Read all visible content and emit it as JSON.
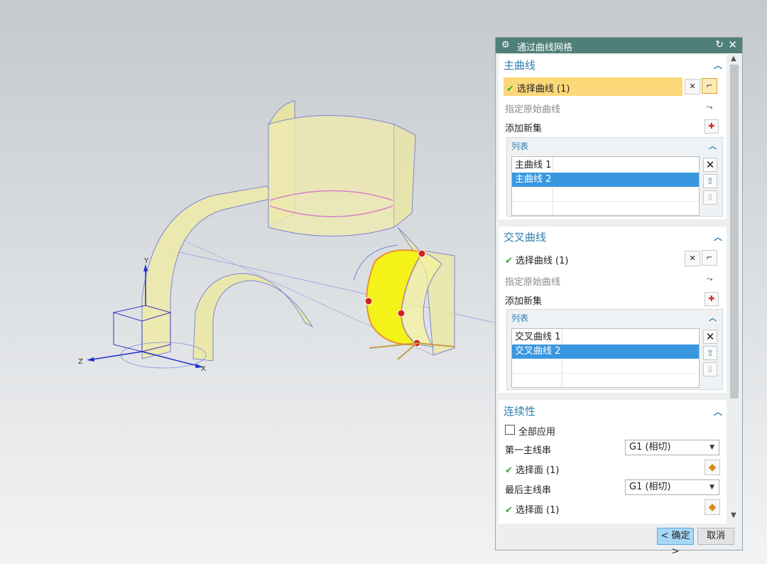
{
  "dialog": {
    "title": "通过曲线网格",
    "icons": {
      "title": "gear-icon",
      "reset": "reset-icon",
      "close": "close-icon"
    }
  },
  "primary": {
    "title": "主曲线",
    "select_label": "选择曲线 (1)",
    "specify_label": "指定原始曲线",
    "add_set_label": "添加新集",
    "list_title": "列表",
    "items": [
      "主曲线 1",
      "主曲线 2"
    ]
  },
  "cross": {
    "title": "交叉曲线",
    "select_label": "选择曲线 (1)",
    "specify_label": "指定原始曲线",
    "add_set_label": "添加新集",
    "list_title": "列表",
    "items": [
      "交叉曲线 1",
      "交叉曲线 2"
    ]
  },
  "continuity": {
    "title": "连续性",
    "apply_all_label": "全部应用",
    "first_label": "第一主线串",
    "first_value": "G1 (相切)",
    "face1_label": "选择面 (1)",
    "last_label": "最后主线串",
    "last_value": "G1 (相切)",
    "face2_label": "选择面 (1)"
  },
  "buttons": {
    "ok": "< 确定 >",
    "cancel": "取消"
  },
  "axes": {
    "x": "X",
    "y": "Y",
    "z": "Z"
  },
  "colors": {
    "accent": "#2e7fae",
    "selection": "#3997e0",
    "highlight_row": "#fcd879",
    "titlebar": "#4f7f79"
  }
}
